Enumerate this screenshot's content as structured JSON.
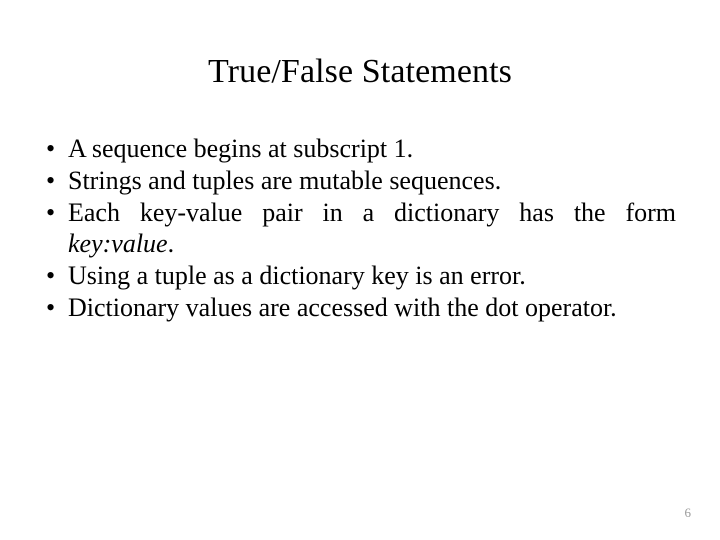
{
  "slide": {
    "title": "True/False Statements",
    "background_color": "#ffffff",
    "text_color": "#000000",
    "bullet_glyph": "•",
    "bullets": [
      {
        "text": "A sequence begins at subscript 1.",
        "pre_italic": "A sequence begins at subscript 1.",
        "italic": "",
        "post_italic": ""
      },
      {
        "text": "Strings and tuples are mutable sequences.",
        "pre_italic": "Strings and tuples are mutable sequences.",
        "italic": "",
        "post_italic": ""
      },
      {
        "text": "Each key-value pair in a dictionary has the form key:value.",
        "pre_italic": "Each key-value pair in a dictionary has the form ",
        "italic": "key:value",
        "post_italic": "."
      },
      {
        "text": "Using a tuple as a dictionary key is an error.",
        "pre_italic": "Using a tuple as a dictionary key is an error.",
        "italic": "",
        "post_italic": ""
      },
      {
        "text": "Dictionary values are accessed with the dot operator.",
        "pre_italic": "Dictionary values are accessed with the dot operator.",
        "italic": "",
        "post_italic": ""
      }
    ],
    "page_number": "6",
    "page_number_color": "#9a9a9a"
  }
}
